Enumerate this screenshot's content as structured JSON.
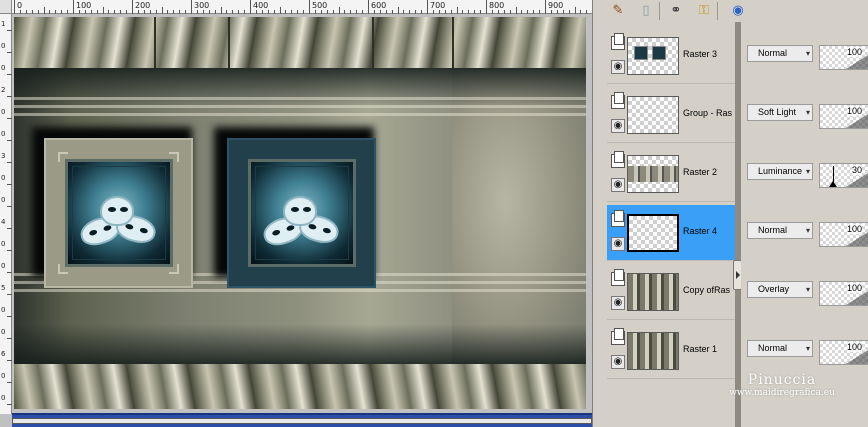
{
  "ruler": {
    "top_labels": [
      "0",
      "100",
      "200",
      "300",
      "400",
      "500",
      "600",
      "700",
      "800",
      "900"
    ],
    "left_labels": [
      "1",
      "0",
      "0",
      "2",
      "0",
      "0",
      "3",
      "0",
      "0",
      "4",
      "0",
      "0",
      "5",
      "0",
      "0",
      "6",
      "0",
      "0"
    ]
  },
  "toolbar": {
    "icons": [
      "paint-brush-icon",
      "document-icon",
      "link-icon",
      "lock-icon",
      "globe-icon"
    ]
  },
  "layers": [
    {
      "name": "Raster 3",
      "blend": "Normal",
      "opacity": "100",
      "thumb": "masks",
      "selected": false
    },
    {
      "name": "Group - Ras",
      "blend": "Soft Light",
      "opacity": "100",
      "thumb": "transparent",
      "selected": false
    },
    {
      "name": "Raster 2",
      "blend": "Luminance",
      "opacity": "30",
      "thumb": "strip",
      "selected": false
    },
    {
      "name": "Raster 4",
      "blend": "Normal",
      "opacity": "100",
      "thumb": "transparent",
      "selected": true
    },
    {
      "name": "Copy ofRas",
      "blend": "Overlay",
      "opacity": "100",
      "thumb": "full",
      "selected": false
    },
    {
      "name": "Raster 1",
      "blend": "Normal",
      "opacity": "100",
      "thumb": "full",
      "selected": false
    }
  ],
  "watermark": {
    "line1": "Pinuccia",
    "line2": "www.maidiregrafica.eu"
  },
  "colors": {
    "selection": "#3a9ff6",
    "scrollbar": "#2b4fa8",
    "panel": "#d4d0c8"
  }
}
